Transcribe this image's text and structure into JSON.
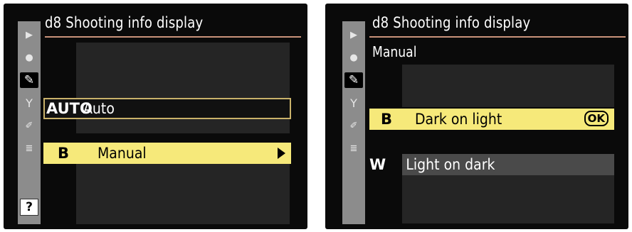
{
  "left_screen": {
    "title": "d8 Shooting info display",
    "sidebar": {
      "icons": [
        "playback-icon",
        "shooting-menu-icon",
        "custom-settings-pencil-icon",
        "setup-wrench-icon",
        "retouch-brush-icon",
        "my-menu-list-icon"
      ],
      "help_label": "?"
    },
    "options": [
      {
        "tag": "AUTO",
        "label": "Auto",
        "state": "outlined"
      },
      {
        "tag": "B",
        "label": "Manual",
        "state": "highlighted"
      }
    ]
  },
  "right_screen": {
    "title": "d8 Shooting info display",
    "subtitle": "Manual",
    "sidebar": {
      "icons": [
        "playback-icon",
        "shooting-menu-icon",
        "custom-settings-pencil-icon",
        "setup-wrench-icon",
        "retouch-brush-icon",
        "my-menu-list-icon"
      ]
    },
    "options": [
      {
        "tag": "B",
        "label": "Dark on light",
        "state": "highlighted",
        "badge": "OK"
      },
      {
        "tag": "W",
        "label": "Light on dark",
        "state": "normal"
      }
    ]
  },
  "colors": {
    "highlight": "#f6e97a",
    "title_rule": "#c9927a",
    "sidebar": "#8c8c8c",
    "background": "#0a0a0a"
  }
}
